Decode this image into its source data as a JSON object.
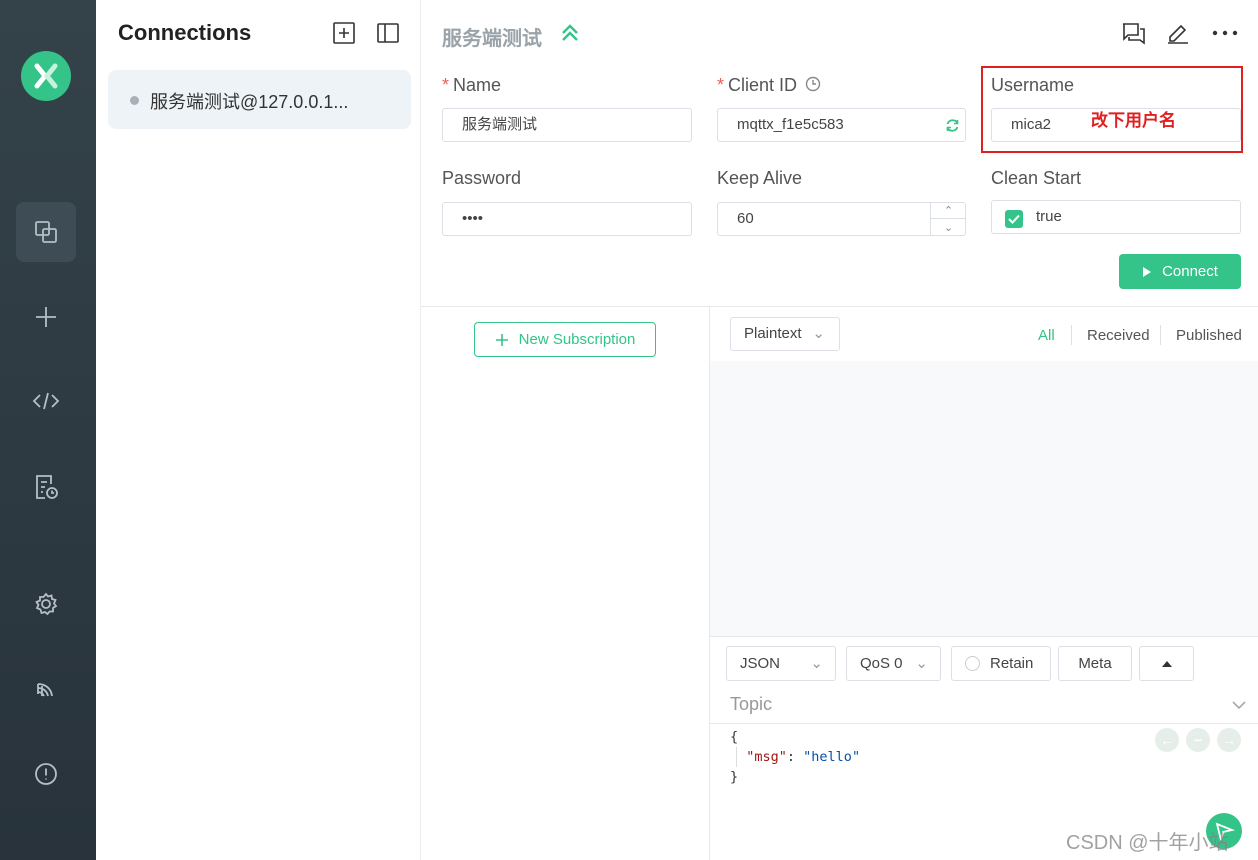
{
  "sidebar": {
    "title": "Connections",
    "connections": [
      {
        "name": "服务端测试@127.0.0.1...",
        "status": "disconnected"
      }
    ]
  },
  "nav_icons": [
    "connections-icon",
    "new-connection-icon",
    "script-icon",
    "log-icon",
    "settings-icon",
    "subscribe-icon",
    "about-icon"
  ],
  "header": {
    "title": "服务端测试"
  },
  "form": {
    "name": {
      "label": "Name",
      "value": "服务端测试",
      "required": "*"
    },
    "client_id": {
      "label": "Client ID",
      "value": "mqttx_f1e5c583",
      "required": "*"
    },
    "username": {
      "label": "Username",
      "value": "mica2"
    },
    "password": {
      "label": "Password",
      "value": "••••"
    },
    "keep_alive": {
      "label": "Keep Alive",
      "value": "60"
    },
    "clean_start": {
      "label": "Clean Start",
      "value": "true"
    },
    "connect_label": "Connect"
  },
  "annotation": "改下用户名",
  "subscriptions": {
    "new_label": "New Subscription"
  },
  "messages": {
    "format": "Plaintext",
    "filters": [
      "All",
      "Received",
      "Published"
    ]
  },
  "publish": {
    "payload_format": "JSON",
    "qos": "QoS 0",
    "retain_label": "Retain",
    "meta_label": "Meta",
    "topic_placeholder": "Topic",
    "payload": {
      "open": "{",
      "key": "\"msg\"",
      "colon": ": ",
      "value": "\"hello\"",
      "close": "}"
    }
  },
  "watermark": "CSDN @十年小站",
  "colors": {
    "accent": "#34c388",
    "rail": "#2d3a42",
    "annotation": "#e02020"
  }
}
